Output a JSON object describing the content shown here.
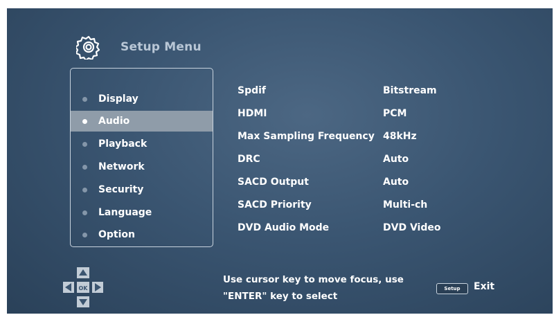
{
  "header": {
    "title": "Setup Menu",
    "icon": "gear-icon"
  },
  "menu": {
    "items": [
      {
        "label": "Display"
      },
      {
        "label": "Audio"
      },
      {
        "label": "Playback"
      },
      {
        "label": "Network"
      },
      {
        "label": "Security"
      },
      {
        "label": "Language"
      },
      {
        "label": "Option"
      }
    ],
    "selected": "Audio"
  },
  "settings": [
    {
      "label": "Spdif",
      "value": "Bitstream"
    },
    {
      "label": "HDMI",
      "value": "PCM"
    },
    {
      "label": "Max Sampling Frequency",
      "value": "48kHz"
    },
    {
      "label": "DRC",
      "value": "Auto"
    },
    {
      "label": "SACD Output",
      "value": "Auto"
    },
    {
      "label": "SACD Priority",
      "value": "Multi-ch"
    },
    {
      "label": "DVD Audio Mode",
      "value": "DVD Video"
    }
  ],
  "footer": {
    "hint_line1": "Use cursor key to move focus, use",
    "hint_line2": "\"ENTER\" key to select",
    "dpad_ok_label": "OK",
    "setup_key_label": "Setup",
    "exit_label": "Exit"
  },
  "colors": {
    "background": "#3a5571",
    "selected_row": "#8f9ca9",
    "title_text": "#b9c7d6"
  }
}
